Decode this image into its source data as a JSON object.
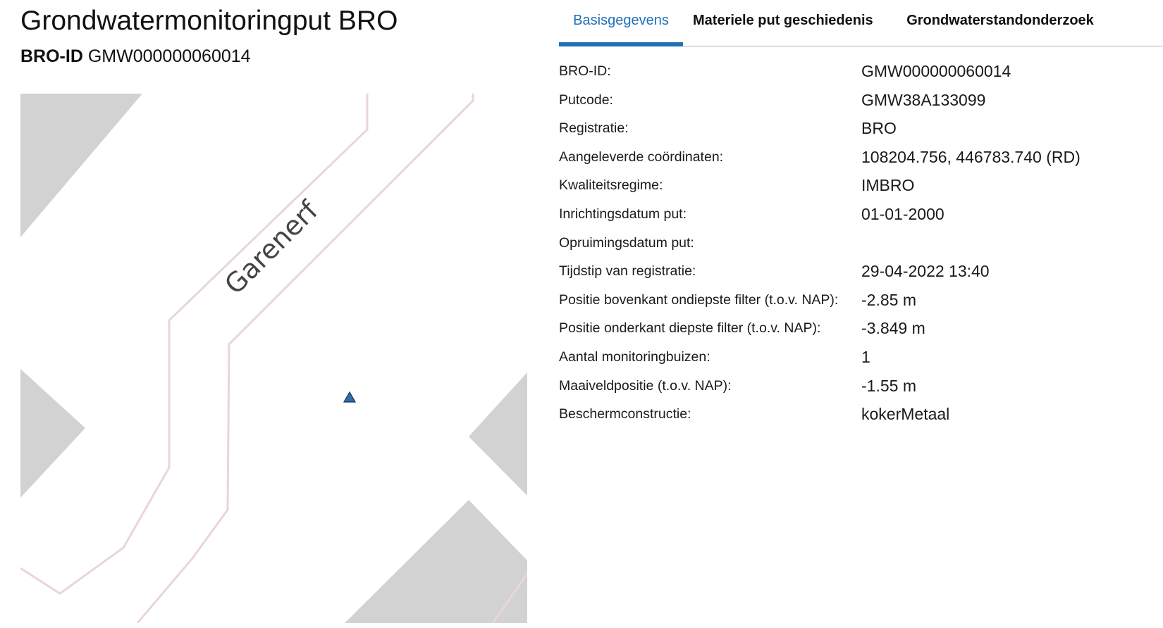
{
  "header": {
    "title": "Grondwatermonitoringput BRO",
    "id_label": "BRO-ID",
    "id_value": "GMW000000060014"
  },
  "map": {
    "street_label": "Garenerf",
    "marker_icon": "triangle-marker-icon",
    "marker_color": "#2a6fb0",
    "building_color": "#d2d2d2",
    "road_outline_color": "#e8d4d4"
  },
  "tabs": [
    {
      "label": "Basisgegevens",
      "active": true
    },
    {
      "label": "Materiele put geschiedenis",
      "active": false
    },
    {
      "label": "Grondwaterstandonderzoek",
      "active": false
    }
  ],
  "details": [
    {
      "label": "BRO-ID:",
      "value": "GMW000000060014"
    },
    {
      "label": "Putcode:",
      "value": "GMW38A133099"
    },
    {
      "label": "Registratie:",
      "value": "BRO"
    },
    {
      "label": "Aangeleverde coördinaten:",
      "value": "108204.756, 446783.740 (RD)"
    },
    {
      "label": "Kwaliteitsregime:",
      "value": "IMBRO"
    },
    {
      "label": "Inrichtingsdatum put:",
      "value": "01-01-2000"
    },
    {
      "label": "Opruimingsdatum put:",
      "value": ""
    },
    {
      "label": "Tijdstip van registratie:",
      "value": "29-04-2022 13:40"
    },
    {
      "label": "Positie bovenkant ondiepste filter (t.o.v. NAP):",
      "value": "-2.85 m"
    },
    {
      "label": "Positie onderkant diepste filter (t.o.v. NAP):",
      "value": "-3.849 m"
    },
    {
      "label": "Aantal monitoringbuizen:",
      "value": "1"
    },
    {
      "label": "Maaiveldpositie (t.o.v. NAP):",
      "value": "-1.55 m"
    },
    {
      "label": "Beschermconstructie:",
      "value": "kokerMetaal"
    }
  ]
}
